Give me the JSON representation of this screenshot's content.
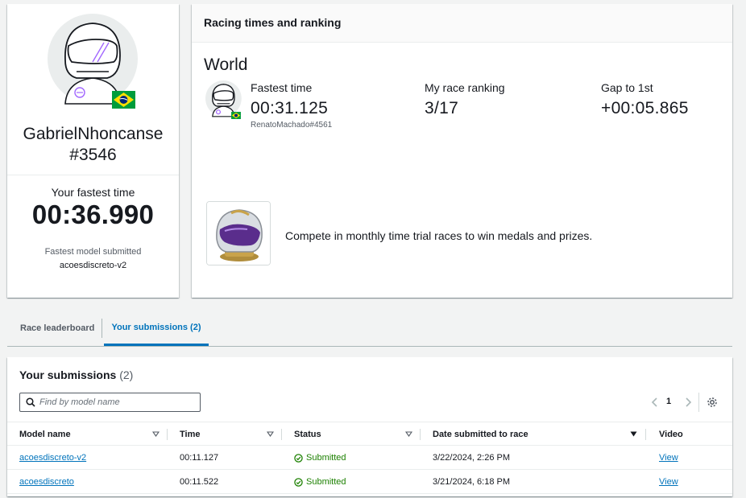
{
  "profile": {
    "name_line1": "GabrielNhoncanse",
    "name_line2": "#3546",
    "fastest_label": "Your fastest time",
    "fastest_value": "00:36.990",
    "model_label": "Fastest model submitted",
    "model_value": "acoesdiscreto-v2",
    "flag": "brazil-flag"
  },
  "racing": {
    "title": "Racing times and ranking",
    "region": "World",
    "fastest_time_label": "Fastest time",
    "fastest_time_value": "00:31.125",
    "fastest_time_holder": "RenatoMachado#4561",
    "ranking_label": "My race ranking",
    "ranking_value": "3/17",
    "gap_label": "Gap to 1st",
    "gap_value": "+00:05.865",
    "compete_text": "Compete in monthly time trial races to win medals and prizes."
  },
  "tabs": [
    {
      "label": "Race leaderboard",
      "active": false
    },
    {
      "label": "Your submissions (2)",
      "active": true
    }
  ],
  "submissions": {
    "title": "Your submissions",
    "count": "(2)",
    "search_placeholder": "Find by model name",
    "page": "1",
    "columns": [
      "Model name",
      "Time",
      "Status",
      "Date submitted to race",
      "Video"
    ],
    "rows": [
      {
        "model": "acoesdiscreto-v2",
        "time": "00:11.127",
        "status": "Submitted",
        "date": "3/22/2024, 2:26 PM",
        "video": "View"
      },
      {
        "model": "acoesdiscreto",
        "time": "00:11.522",
        "status": "Submitted",
        "date": "3/21/2024, 6:18 PM",
        "video": "View"
      }
    ]
  },
  "colors": {
    "link": "#0073bb",
    "success": "#1d8102",
    "text": "#16191f"
  }
}
